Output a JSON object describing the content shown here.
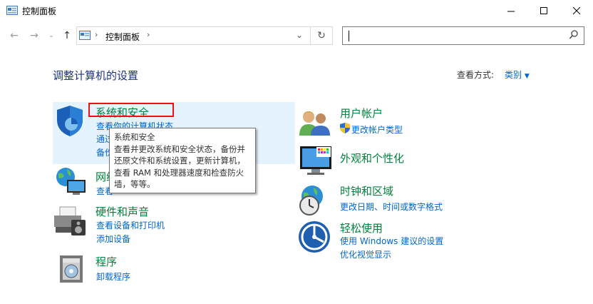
{
  "window": {
    "title": "控制面板"
  },
  "address": {
    "crumb": "控制面板"
  },
  "search": {
    "placeholder": ""
  },
  "heading": "调整计算机的设置",
  "view": {
    "label": "查看方式:",
    "value": "类别"
  },
  "categories": {
    "system": {
      "title": "系统和安全",
      "links": [
        "查看你的计算机状态",
        "通过",
        "备份"
      ]
    },
    "network": {
      "title": "网络",
      "links": [
        "查看"
      ]
    },
    "hardware": {
      "title": "硬件和声音",
      "links": [
        "查看设备和打印机",
        "添加设备"
      ]
    },
    "programs": {
      "title": "程序",
      "links": [
        "卸载程序"
      ]
    },
    "user": {
      "title": "用户帐户",
      "links": [
        "更改帐户类型"
      ]
    },
    "appearance": {
      "title": "外观和个性化",
      "links": []
    },
    "clock": {
      "title": "时钟和区域",
      "links": [
        "更改日期、时间或数字格式"
      ]
    },
    "ease": {
      "title": "轻松使用",
      "links": [
        "使用 Windows 建议的设置",
        "优化视觉显示"
      ]
    }
  },
  "tooltip": {
    "title": "系统和安全",
    "lines": [
      "查看并更改系统和安全状态，备份并",
      "还原文件和系统设置，更新计算机，",
      "查看 RAM 和处理器速度和检查防火",
      "墙，等等。"
    ]
  },
  "colors": {
    "link": "#0066cc",
    "category": "#00823c",
    "heading": "#1e3287",
    "highlight": "#e5f3ff",
    "focus": "#e11111"
  },
  "icons": [
    "control-panel-icon",
    "back-icon",
    "forward-icon",
    "dropdown-icon",
    "up-icon",
    "chevron-right-icon",
    "refresh-icon",
    "search-icon",
    "shield-icon",
    "network-icon",
    "printer-icon",
    "programs-icon",
    "users-icon",
    "monitor-icon",
    "clock-icon",
    "accessibility-icon",
    "uac-shield-icon"
  ]
}
